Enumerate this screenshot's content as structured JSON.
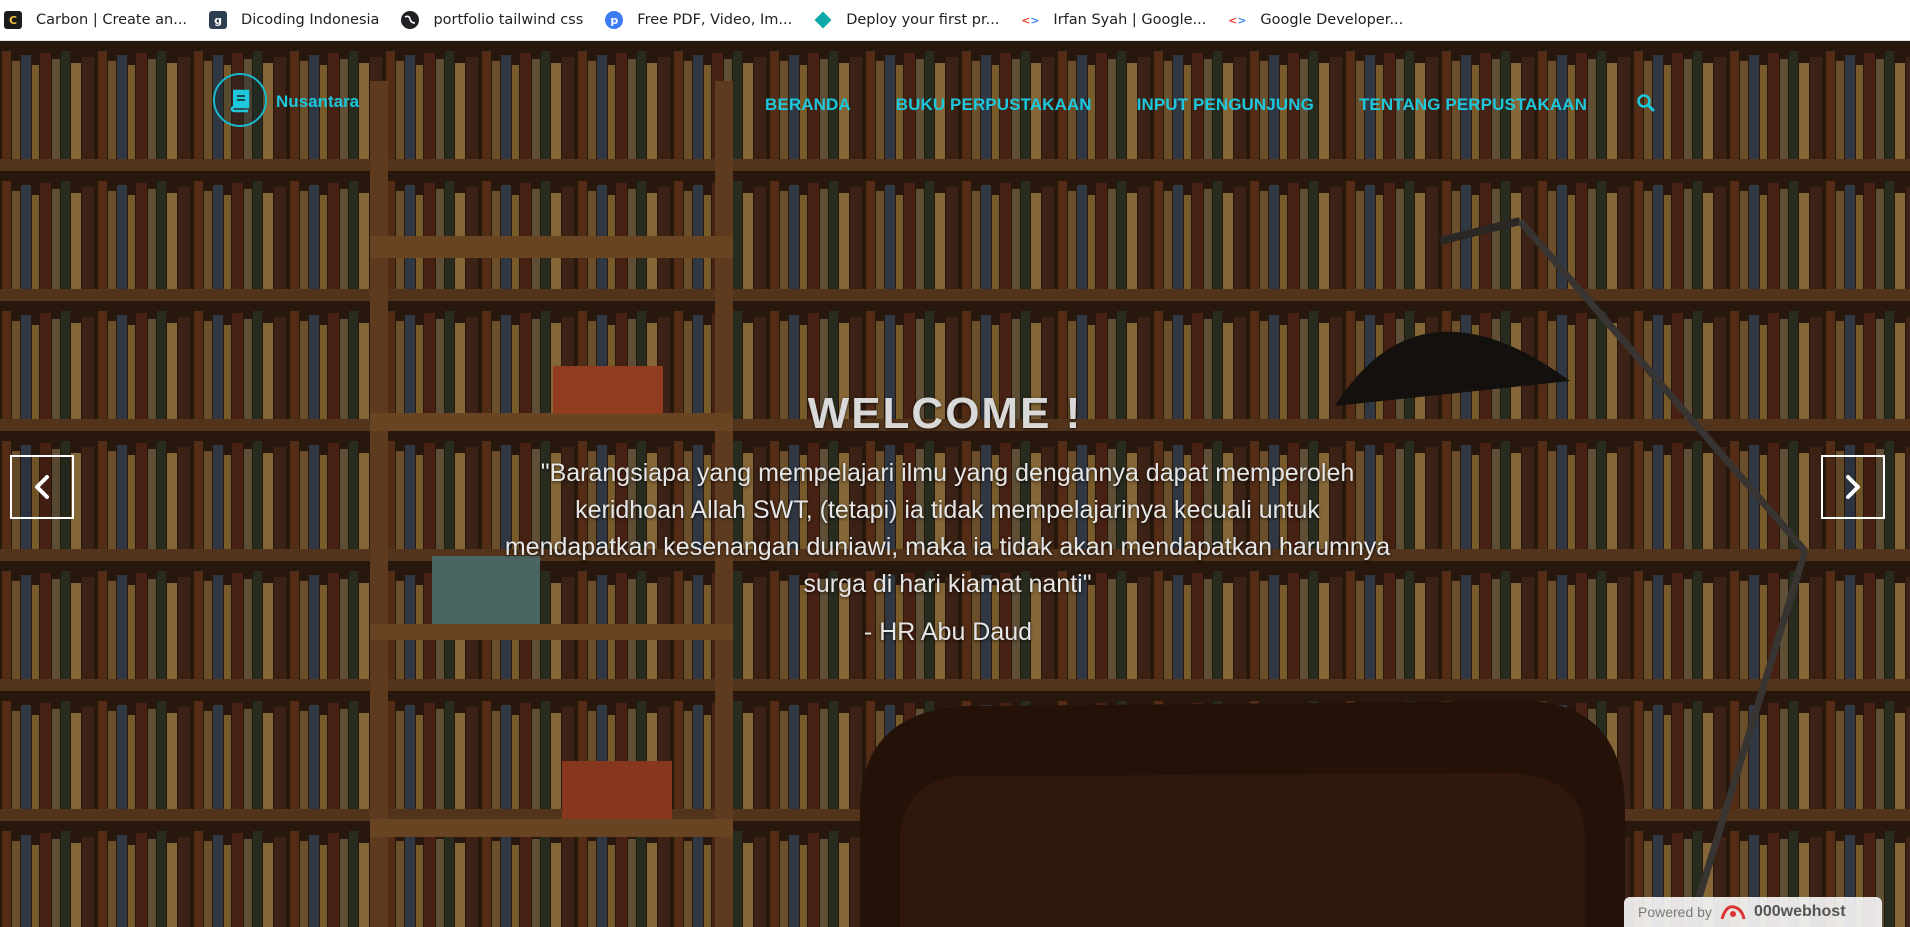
{
  "bookmarks": [
    {
      "label": "Carbon | Create an...",
      "icon": "carbon-icon"
    },
    {
      "label": "Dicoding Indonesia",
      "icon": "dicoding-icon"
    },
    {
      "label": "portfolio tailwind css",
      "icon": "globe-icon"
    },
    {
      "label": "Free PDF, Video, Im...",
      "icon": "pdf-icon"
    },
    {
      "label": "Deploy your first pr...",
      "icon": "diamond-icon"
    },
    {
      "label": "Irfan Syah | Google...",
      "icon": "code-icon"
    },
    {
      "label": "Google Developer...",
      "icon": "code-icon"
    }
  ],
  "navbar": {
    "brand": "Nusantara",
    "links": [
      "BERANDA",
      "BUKU PERPUSTAKAAN",
      "INPUT PENGUNJUNG",
      "TENTANG PERPUSTAKAAN"
    ],
    "accent_color": "#1dc7dc"
  },
  "hero": {
    "title": "WELCOME !",
    "quote_lines": [
      "\"Barangsiapa yang mempelajari ilmu yang dengannya dapat memperoleh",
      "keridhoan Allah SWT, (tetapi) ia tidak mempelajarinya kecuali untuk",
      "mendapatkan kesenangan duniawi, maka ia tidak akan mendapatkan harumnya",
      "surga di hari kiamat nanti\""
    ],
    "author": "- HR Abu Daud"
  },
  "footer_badge": {
    "powered_label": "Powered by",
    "host": "000webhost"
  }
}
